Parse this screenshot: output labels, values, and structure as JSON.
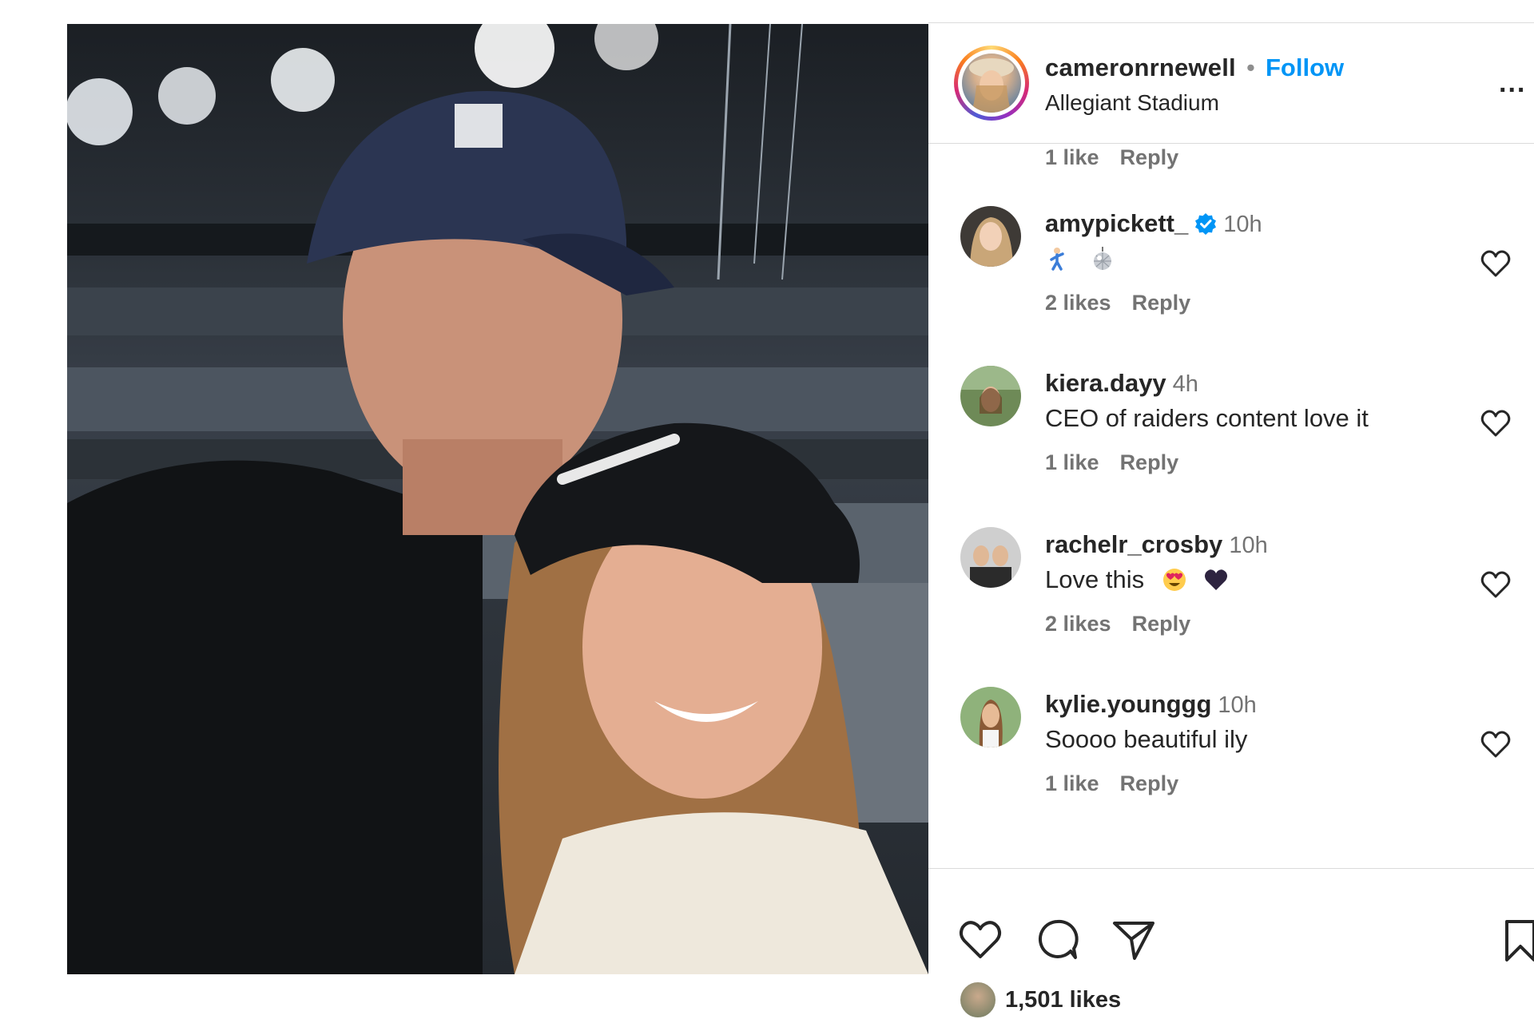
{
  "post": {
    "username": "cameronrnewell",
    "separator": "•",
    "follow_label": "Follow",
    "location": "Allegiant Stadium",
    "more_label": "..."
  },
  "comments": {
    "first_meta": {
      "likes": "1 like",
      "reply": "Reply"
    },
    "items": [
      {
        "user": "amypickett_",
        "verified": true,
        "time": "10h",
        "text": "",
        "emojis": [
          "person-dancing-emoji",
          "disco-ball-emoji"
        ],
        "likes": "2 likes",
        "reply": "Reply"
      },
      {
        "user": "kiera.dayy",
        "verified": false,
        "time": "4h",
        "text": "CEO of raiders content love it",
        "emojis": [],
        "likes": "1 like",
        "reply": "Reply"
      },
      {
        "user": "rachelr_crosby",
        "verified": false,
        "time": "10h",
        "text": "Love this",
        "emojis": [
          "heart-eyes-emoji",
          "black-heart-emoji"
        ],
        "likes": "2 likes",
        "reply": "Reply"
      },
      {
        "user": "kylie.younggg",
        "verified": false,
        "time": "10h",
        "text": "Soooo beautiful ily",
        "emojis": [],
        "likes": "1 like",
        "reply": "Reply"
      }
    ]
  },
  "footer": {
    "likes_count": "1,501 likes"
  },
  "colors": {
    "link_blue": "#0095f6",
    "secondary_text": "#737373",
    "divider": "#dbdbdb"
  }
}
